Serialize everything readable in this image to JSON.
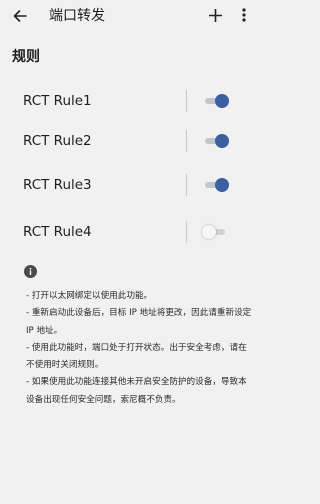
{
  "app_bar": {
    "title": "端口转发",
    "back_icon": "arrow-back-icon",
    "add_icon": "plus-icon",
    "more_icon": "more-vert-icon"
  },
  "section": {
    "title": "规则"
  },
  "rules": [
    {
      "name": "RCT Rule1",
      "enabled": true
    },
    {
      "name": "RCT Rule2",
      "enabled": true
    },
    {
      "name": "RCT Rule3",
      "enabled": true
    },
    {
      "name": "RCT Rule4",
      "enabled": false
    }
  ],
  "info": {
    "icon": "info-icon",
    "notes": [
      "- 打开以太网绑定以使用此功能。",
      "- 重新启动此设备后，目标 IP 地址将更改，因此请重新设定 IP 地址。",
      "- 使用此功能时，端口处于打开状态。出于安全考虑，请在不使用时关闭规则。",
      "- 如果使用此功能连接其他未开启安全防护的设备，导致本设备出现任何安全问题，索尼概不负责。"
    ]
  },
  "colors": {
    "background": "#f1f1f1",
    "switch_on": "#3c5fa0",
    "switch_off_track": "#d3d3d3"
  }
}
